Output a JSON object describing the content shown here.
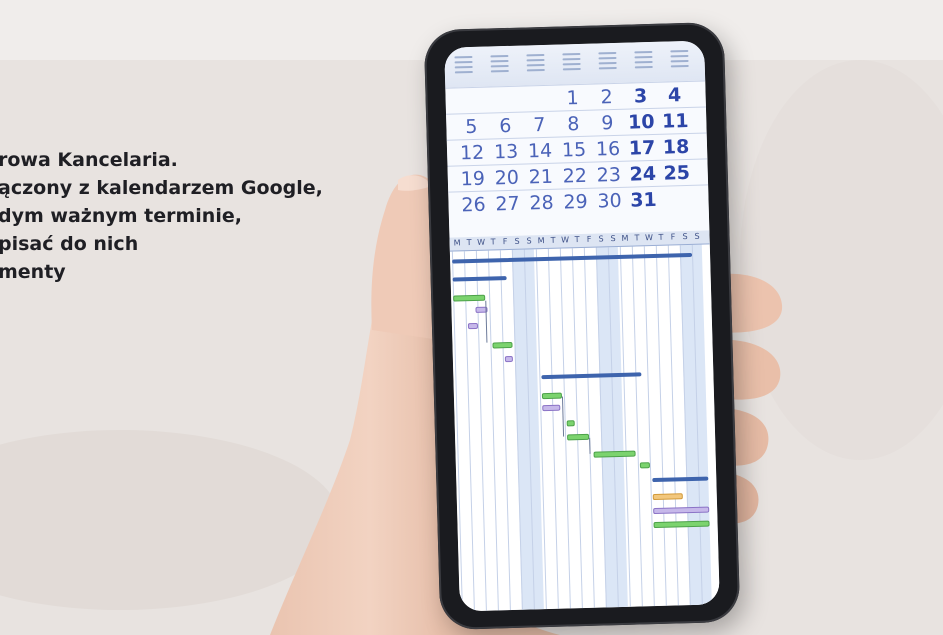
{
  "promo": {
    "lines": [
      "rowa Kancelaria.",
      "ączony z kalendarzem Google,",
      "dym ważnym terminie,",
      "pisać do nich",
      "menty"
    ]
  },
  "calendar": {
    "weeks": [
      [
        "",
        "",
        "",
        "1",
        "2",
        "3",
        "4"
      ],
      [
        "5",
        "6",
        "7",
        "8",
        "9",
        "10",
        "11"
      ],
      [
        "12",
        "13",
        "14",
        "15",
        "16",
        "17",
        "18"
      ],
      [
        "19",
        "20",
        "21",
        "22",
        "23",
        "24",
        "25"
      ],
      [
        "26",
        "27",
        "28",
        "29",
        "30",
        "31",
        ""
      ]
    ]
  },
  "gantt": {
    "day_letters": [
      "M",
      "T",
      "W",
      "T",
      "F",
      "S",
      "S",
      "M",
      "T",
      "W",
      "T",
      "F",
      "S",
      "S",
      "M",
      "T",
      "W",
      "T",
      "F",
      "S",
      "S"
    ]
  },
  "colors": {
    "accent": "#4b63b8",
    "summary_bar": "#3e64ad",
    "task_green": "#7bd36e",
    "task_purple": "#c6b8ea",
    "task_orange": "#f2c77d"
  }
}
